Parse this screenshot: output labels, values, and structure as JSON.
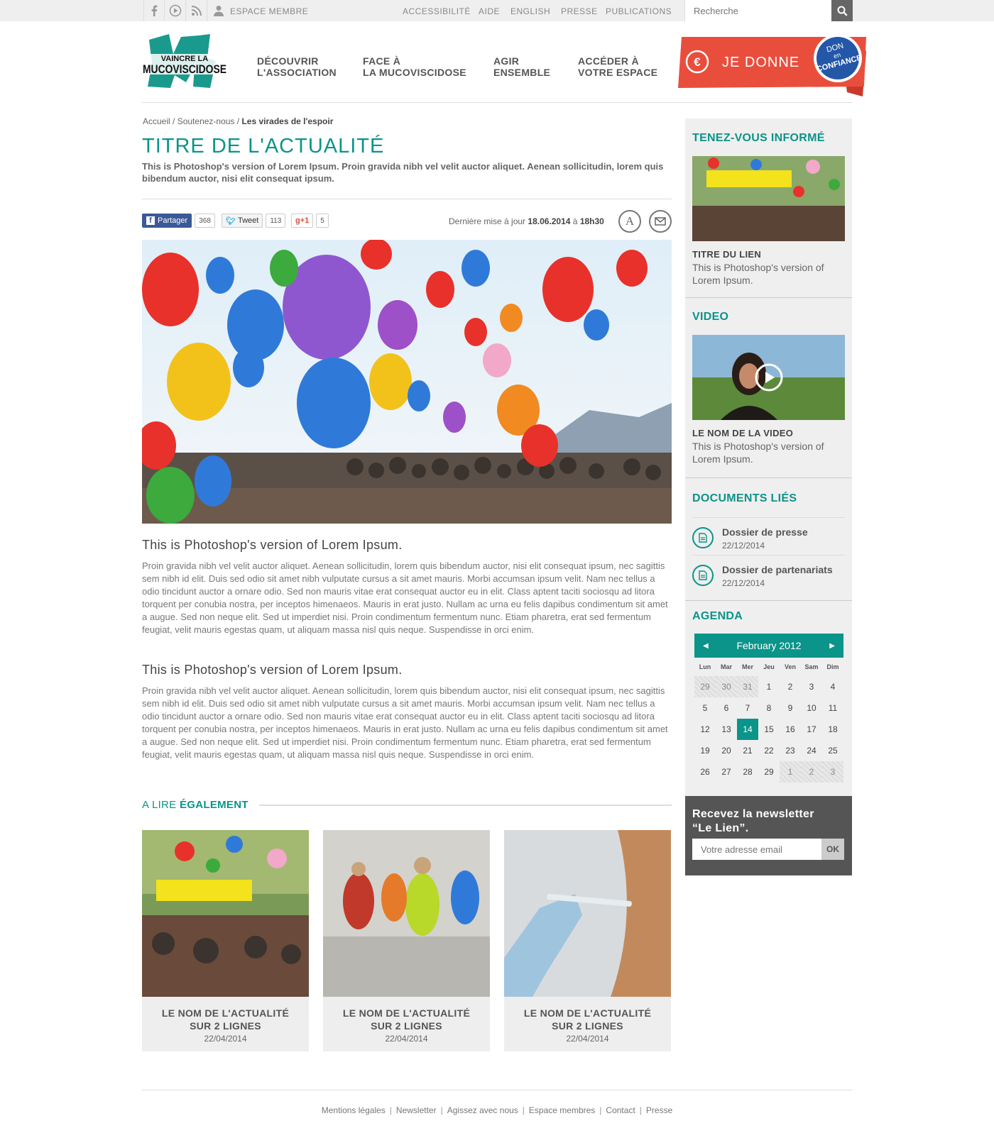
{
  "topbar": {
    "member_label": "ESPACE MEMBRE",
    "links": [
      "ACCESSIBILITÉ",
      "AIDE",
      "ENGLISH",
      "PRESSE",
      "PUBLICATIONS"
    ],
    "search_placeholder": "Recherche"
  },
  "logo": {
    "line1": "VAINCRE LA",
    "line2": "MUCOVISCIDOSE"
  },
  "nav": [
    {
      "l1": "DÉCOUVRIR",
      "l2": "L'ASSOCIATION"
    },
    {
      "l1": "FACE À",
      "l2": "LA MUCOVISCIDOSE"
    },
    {
      "l1": "AGIR",
      "l2": "ENSEMBLE"
    },
    {
      "l1": "ACCÉDER À",
      "l2": "VOTRE ESPACE"
    }
  ],
  "donate": {
    "label": "JE DONNE",
    "badge_l1": "DON",
    "badge_l2": "en",
    "badge_l3": "CONFIANCE"
  },
  "breadcrumb": {
    "home": "Accueil",
    "parent": "Soutenez-nous",
    "current": "Les virades de l'espoir"
  },
  "article": {
    "title": "TITRE DE L'ACTUALITÉ",
    "lead": "This is Photoshop's version  of Lorem Ipsum. Proin gravida nibh vel velit auctor aliquet. Aenean sollicitudin, lorem quis bibendum auctor, nisi elit consequat ipsum.",
    "share": {
      "fb_label": "Partager",
      "fb_count": "368",
      "tw_label": "Tweet",
      "tw_count": "113",
      "gp_label": "+1",
      "gp_count": "5"
    },
    "updated_prefix": "Dernière mise à jour",
    "updated_date": "18.06.2014",
    "updated_mid": "à",
    "updated_time": "18h30",
    "sections": [
      {
        "heading": "This is Photoshop's version of Lorem Ipsum.",
        "body": "Proin gravida nibh vel velit auctor aliquet. Aenean sollicitudin, lorem quis bibendum auctor, nisi elit consequat ipsum, nec sagittis sem nibh id elit. Duis sed odio sit amet nibh vulputate cursus a sit amet mauris. Morbi accumsan ipsum velit. Nam nec tellus a odio tincidunt auctor a ornare odio. Sed non  mauris vitae erat consequat auctor eu in elit. Class aptent taciti sociosqu ad litora torquent per conubia nostra, per inceptos himenaeos. Mauris in erat justo. Nullam ac urna eu felis dapibus condimentum sit amet a augue. Sed non neque elit. Sed ut imperdiet nisi. Proin condimentum fermentum nunc. Etiam pharetra, erat sed fermentum feugiat, velit mauris egestas quam, ut aliquam massa nisl quis neque. Suspendisse in orci enim."
      },
      {
        "heading": "This is Photoshop's version of Lorem Ipsum.",
        "body": "Proin gravida nibh vel velit auctor aliquet. Aenean sollicitudin, lorem quis bibendum auctor, nisi elit consequat ipsum, nec sagittis sem nibh id elit. Duis sed odio sit amet nibh vulputate cursus a sit amet mauris. Morbi accumsan ipsum velit. Nam nec tellus a odio tincidunt auctor a ornare odio. Sed non mauris vitae erat consequat auctor eu in elit. Class aptent taciti sociosqu ad litora torquent per conubia nostra, per inceptos himenaeos. Mauris in erat justo. Nullam ac urna eu felis dapibus condimentum sit amet a augue. Sed non neque elit. Sed ut imperdiet nisi. Proin condimentum fermentum nunc. Etiam pharetra, erat sed fermentum feugiat, velit mauris egestas quam, ut aliquam massa nisl quis neque. Suspendisse in orci enim."
      }
    ]
  },
  "also": {
    "heading_a": "A LIRE ",
    "heading_b": "ÉGALEMENT",
    "cards": [
      {
        "l1": "LE NOM DE L'ACTUALITÉ",
        "l2": "SUR 2 LIGNES",
        "date": "22/04/2014"
      },
      {
        "l1": "LE NOM DE L'ACTUALITÉ",
        "l2": "SUR 2 LIGNES",
        "date": "22/04/2014"
      },
      {
        "l1": "LE NOM DE L'ACTUALITÉ",
        "l2": "SUR 2 LIGNES",
        "date": "22/04/2014"
      }
    ]
  },
  "sidebar": {
    "informed": {
      "heading": "TENEZ-VOUS INFORMÉ",
      "title": "TITRE DU LIEN",
      "text": "This is Photoshop's version of Lorem Ipsum."
    },
    "video": {
      "heading": "VIDEO",
      "title": "LE NOM DE LA VIDEO",
      "text": "This is Photoshop's version of Lorem Ipsum."
    },
    "documents": {
      "heading": "DOCUMENTS LIÉS",
      "items": [
        {
          "title": "Dossier de presse",
          "date": "22/12/2014"
        },
        {
          "title": "Dossier de partenariats",
          "date": "22/12/2014"
        }
      ]
    },
    "agenda": {
      "heading": "AGENDA",
      "month": "February 2012",
      "days": [
        "Lun",
        "Mar",
        "Mer",
        "Jeu",
        "Ven",
        "Sam",
        "Dim"
      ],
      "weeks": [
        [
          "29",
          "30",
          "31",
          "1",
          "2",
          "3",
          "4"
        ],
        [
          "5",
          "6",
          "7",
          "8",
          "9",
          "10",
          "11"
        ],
        [
          "12",
          "13",
          "14",
          "15",
          "16",
          "17",
          "18"
        ],
        [
          "19",
          "20",
          "21",
          "22",
          "23",
          "24",
          "25"
        ],
        [
          "26",
          "27",
          "28",
          "29",
          "1",
          "2",
          "3"
        ]
      ],
      "today": "14"
    },
    "newsletter": {
      "l1": "Recevez la newsletter",
      "l2": "“Le Lien”.",
      "placeholder": "Votre adresse email",
      "ok": "OK"
    }
  },
  "footer": [
    "Mentions légales",
    "Newsletter",
    "Agissez avec nous",
    "Espace membres",
    "Contact",
    "Presse"
  ],
  "colors": {
    "accent": "#0b9489",
    "donate": "#e94e3d",
    "badge": "#2457a8"
  }
}
